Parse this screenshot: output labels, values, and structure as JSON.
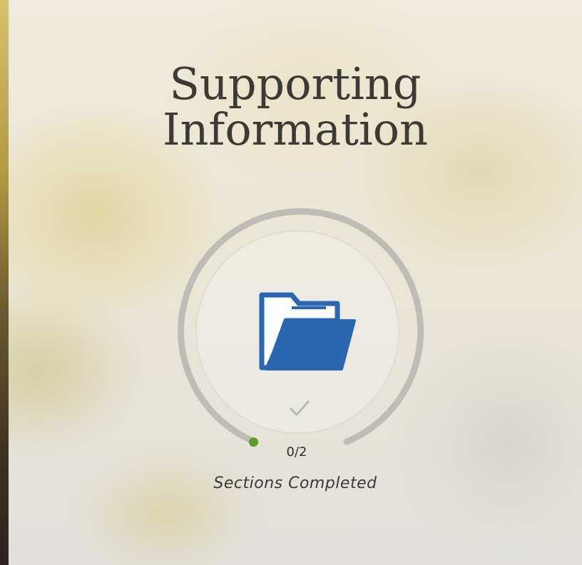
{
  "card": {
    "title_line1": "Supporting",
    "title_line2": "Information",
    "icon": "folder-open-icon",
    "status_icon": "checkmark-icon",
    "progress": {
      "completed": 0,
      "total": 2,
      "label": "0/2",
      "fraction": 0
    },
    "caption": "Sections Completed"
  },
  "colors": {
    "folder": "#2b66b1",
    "ring": "#bdbcb7",
    "progress_dot": "#5a9e2a",
    "title": "#3c3a36"
  }
}
